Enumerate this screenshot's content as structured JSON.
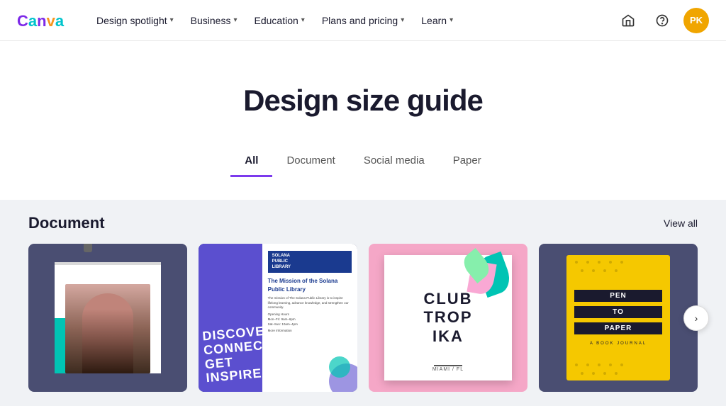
{
  "navbar": {
    "logo": "Canva",
    "items": [
      {
        "label": "Design spotlight",
        "hasDropdown": true
      },
      {
        "label": "Business",
        "hasDropdown": true
      },
      {
        "label": "Education",
        "hasDropdown": true
      },
      {
        "label": "Plans and pricing",
        "hasDropdown": true
      },
      {
        "label": "Learn",
        "hasDropdown": true
      }
    ],
    "right": {
      "home_icon": "⌂",
      "help_icon": "?",
      "avatar_initials": "PK"
    }
  },
  "hero": {
    "title": "Design size guide"
  },
  "tabs": [
    {
      "label": "All",
      "active": true
    },
    {
      "label": "Document",
      "active": false
    },
    {
      "label": "Social media",
      "active": false
    },
    {
      "label": "Paper",
      "active": false
    }
  ],
  "document_section": {
    "title": "Document",
    "view_all": "View all",
    "cards": [
      {
        "id": "card-1",
        "type": "portrait-photo",
        "description": "Portrait with teal background"
      },
      {
        "id": "card-2",
        "type": "library-poster",
        "header_small": "SOLANA\nPUBLIC\nLIBRARY",
        "title": "The Mission of the Solana Public Library",
        "body": "The mission of The Solana Public Library is to inspire lifelong learning, advance knowledge, and strengthen our community.",
        "discover_text": "DISCOVER\nCONNECT\nGET INSPIRED"
      },
      {
        "id": "card-3",
        "type": "club-tropika",
        "main_text": "CLUB\nTROP\nIKA",
        "sub_text": "MIAMI / FL"
      },
      {
        "id": "card-4",
        "type": "pen-to-paper",
        "labels": [
          "PEN",
          "TO",
          "PAPER"
        ],
        "subtitle": "A BOOK JOURNAL"
      }
    ],
    "next_arrow": "›"
  }
}
